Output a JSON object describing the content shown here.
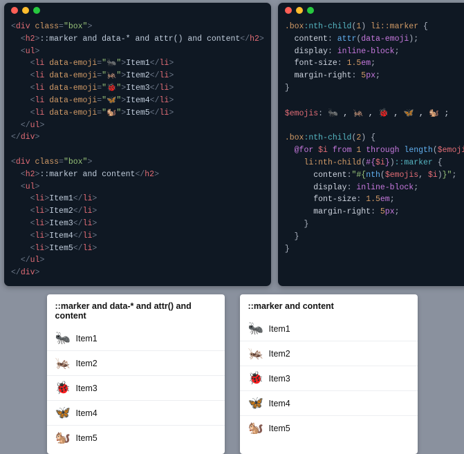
{
  "left_editor": {
    "html_src": {
      "box1": {
        "open_div": {
          "tag": "div",
          "attr": "class",
          "attr_val": "\"box\""
        },
        "h2_text": "::marker and data-* and attr() and content",
        "lis": [
          {
            "emoji": "\"🐜\"",
            "text": "Item1"
          },
          {
            "emoji": "\"🦗\"",
            "text": "Item2"
          },
          {
            "emoji": "\"🐞\"",
            "text": "Item3"
          },
          {
            "emoji": "\"🦋\"",
            "text": "Item4"
          },
          {
            "emoji": "\"🐿️\"",
            "text": "Item5"
          }
        ]
      },
      "box2": {
        "h2_text": "::marker and content",
        "lis": [
          {
            "text": "Item1"
          },
          {
            "text": "Item2"
          },
          {
            "text": "Item3"
          },
          {
            "text": "Item4"
          },
          {
            "text": "Item5"
          }
        ]
      }
    }
  },
  "right_editor": {
    "rule1": {
      "selector_box": ".box",
      "nth_child_num": "1",
      "li_marker": "li::marker",
      "content_prop": "content",
      "attr_fn": "attr",
      "attr_arg": "data-emoji",
      "display_prop": "display",
      "display_val": "inline-block",
      "fs_prop": "font-size",
      "fs_val": "1.5",
      "fs_unit": "em",
      "mr_prop": "margin-right",
      "mr_val": "5",
      "mr_unit": "px"
    },
    "emojis_var": "$emojis",
    "emojis_list": "🐜 , 🦗 , 🐞 , 🦋 , 🐿️ ;",
    "rule2": {
      "selector_box": ".box",
      "nth_child_num": "2",
      "for_kw": "@for",
      "i_var": "$i",
      "from_kw": "from",
      "from_num": "1",
      "through_kw": "through",
      "length_fn": "length",
      "length_arg": "$emojis",
      "li_nth": "li:nth-child",
      "interp_open": "#{",
      "interp_close": "}",
      "marker_pseu": "::marker",
      "content_prop": "content",
      "nth_fn": "nth",
      "nth_arg1": "$emojis",
      "nth_arg2": "$i",
      "display_prop": "display",
      "display_val": "inline-block",
      "fs_prop": "font-size",
      "fs_val": "1.5",
      "fs_unit": "em",
      "mr_prop": "margin-right",
      "mr_val": "5",
      "mr_unit": "px"
    }
  },
  "demo": {
    "box1_title": "::marker and data-* and attr() and content",
    "box2_title": "::marker and content",
    "items": [
      {
        "emoji": "🐜",
        "label": "Item1"
      },
      {
        "emoji": "🦗",
        "label": "Item2"
      },
      {
        "emoji": "🐞",
        "label": "Item3"
      },
      {
        "emoji": "🦋",
        "label": "Item4"
      },
      {
        "emoji": "🐿️",
        "label": "Item5"
      }
    ]
  }
}
